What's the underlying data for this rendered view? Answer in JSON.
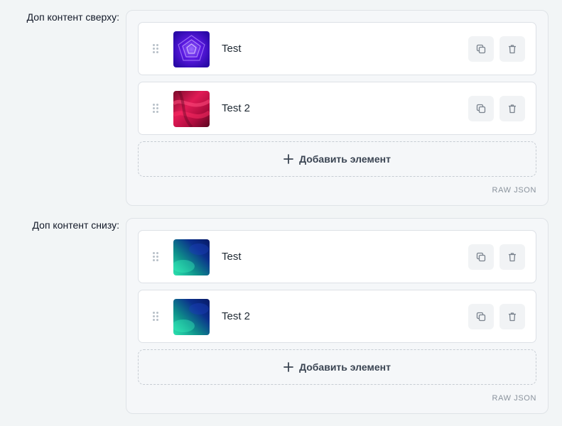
{
  "groups": [
    {
      "label": "Доп контент сверху:",
      "items": [
        {
          "title": "Test",
          "thumbnail": "purple-vortex"
        },
        {
          "title": "Test 2",
          "thumbnail": "red-fabric"
        }
      ],
      "add_label": "Добавить элемент",
      "raw_json_label": "RAW JSON"
    },
    {
      "label": "Доп контент снизу:",
      "items": [
        {
          "title": "Test",
          "thumbnail": "teal-aurora"
        },
        {
          "title": "Test 2",
          "thumbnail": "teal-aurora"
        }
      ],
      "add_label": "Добавить элемент",
      "raw_json_label": "RAW JSON"
    }
  ],
  "icons": {
    "drag": "drag-handle-icon",
    "copy": "copy-icon",
    "delete": "trash-icon",
    "add": "plus-icon"
  },
  "colors": {
    "page_bg": "#f2f5f6",
    "panel_bg": "#f5f7f9",
    "card_bg": "#ffffff",
    "icon_button_bg": "#f1f3f5",
    "dashed_border": "#c6ccd3"
  }
}
